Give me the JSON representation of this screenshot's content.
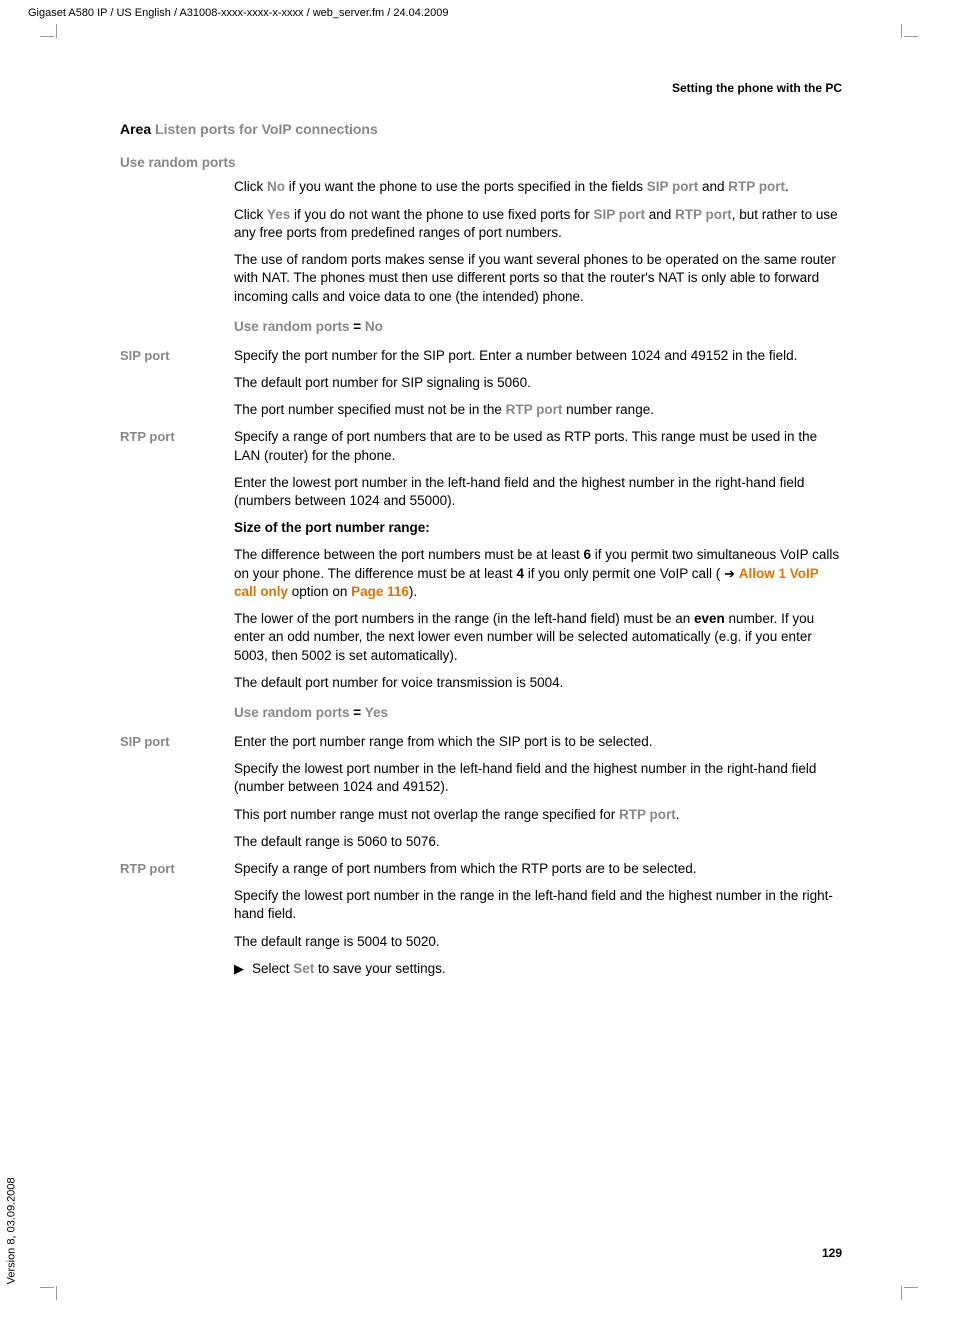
{
  "header_line": "Gigaset A580 IP / US English / A31008-xxxx-xxxx-x-xxxx / web_server.fm / 24.04.2009",
  "running_header": "Setting the phone with the PC",
  "section": {
    "prefix": "Area ",
    "title": "Listen ports for VoIP connections"
  },
  "use_random_ports_label": "Use random ports",
  "p1a": "Click ",
  "p1_no": "No",
  "p1b": " if you want the phone to use the ports specified in the fields ",
  "p1_sip": "SIP port",
  "p1c": " and ",
  "p1_rtp": "RTP port",
  "p1d": ".",
  "p2a": "Click ",
  "p2_yes": "Yes",
  "p2b": " if you do not want the phone to use fixed ports for ",
  "p2_sip": "SIP port",
  "p2c": " and ",
  "p2_rtp": "RTP port",
  "p2d": ", but rather to use any free ports from predefined ranges of port numbers.",
  "p3": "The use of random ports makes sense if you want several phones to be operated on the same router with NAT. The phones must then use different ports so that the router's NAT is only able to forward incoming calls and voice data to one (the intended) phone.",
  "mid1_prefix": "Use random ports",
  "mid1_eq": " = ",
  "mid1_val": "No",
  "sip_label": "SIP port",
  "sip1_p1": "Specify the port number for the SIP port. Enter a number between 1024 and 49152 in the field.",
  "sip1_p2": "The default port number for SIP signaling is 5060.",
  "sip1_p3a": "The port number specified must not be in the ",
  "sip1_p3_rtp": "RTP port",
  "sip1_p3b": " number range.",
  "rtp_label": "RTP port",
  "rtp1_p1": "Specify a range of port numbers that are to be used as RTP ports. This range must be used in the LAN (router) for the phone.",
  "rtp1_p2": "Enter the lowest port number in the left-hand field and the highest number in the right-hand field (numbers between 1024 and 55000).",
  "rtp1_size_title": "Size of the port number range:",
  "rtp1_p3a": "The difference between the port numbers must be at least ",
  "rtp1_p3_6": "6",
  "rtp1_p3b": " if you permit two simultaneous VoIP calls on your phone. The difference must be at least ",
  "rtp1_p3_4": "4",
  "rtp1_p3c": " if you only permit one VoIP call ( ",
  "rtp1_p3_link1": "Allow 1 VoIP call only",
  "rtp1_p3d": " option on ",
  "rtp1_p3_link2": "Page 116",
  "rtp1_p3e": ").",
  "rtp1_p4a": "The lower of the port numbers in the range (in the left-hand field) must be an ",
  "rtp1_p4_even": "even",
  "rtp1_p4b": " number. If you enter an odd number, the next lower even number will be selected automatically (e.g. if you enter 5003, then 5002 is set automatically).",
  "rtp1_p5": "The default port number for voice transmission is 5004.",
  "mid2_prefix": "Use random ports",
  "mid2_eq": " = ",
  "mid2_val": "Yes",
  "sip2_p1": "Enter the port number range from which the SIP port is to be selected.",
  "sip2_p2": "Specify the lowest port number in the left-hand field and the highest number in the right-hand field (number between 1024 and 49152).",
  "sip2_p3a": "This port number range must not overlap the range specified for ",
  "sip2_p3_rtp": "RTP port",
  "sip2_p3b": ".",
  "sip2_p4": "The default range is 5060 to 5076.",
  "rtp2_p1": "Specify a range of port numbers from which the RTP ports are to be selected.",
  "rtp2_p2": "Specify the lowest port number in the range in the left-hand field and the highest number in the right-hand field.",
  "rtp2_p3": "The default range is 5004 to 5020.",
  "final_a": "Select ",
  "final_set": "Set",
  "final_b": " to save your settings.",
  "page_number": "129",
  "version_text": "Version 8, 03.09.2008"
}
